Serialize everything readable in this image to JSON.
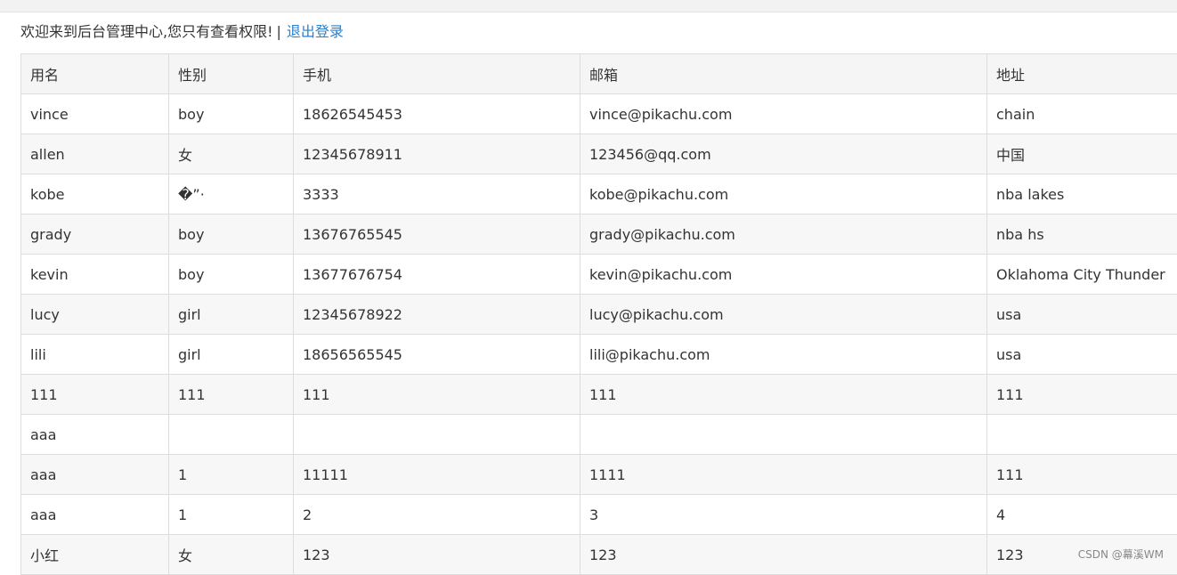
{
  "header": {
    "welcome_text": "欢迎来到后台管理中心,您只有查看权限!",
    "separator": "|",
    "logout_label": "退出登录"
  },
  "table": {
    "columns": [
      "用名",
      "性别",
      "手机",
      "邮箱",
      "地址"
    ],
    "rows": [
      [
        "vince",
        "boy",
        "18626545453",
        "vince@pikachu.com",
        "chain"
      ],
      [
        "allen",
        "女",
        "12345678911",
        "123456@qq.com",
        "中国"
      ],
      [
        "kobe",
        "�”·",
        "3333",
        "kobe@pikachu.com",
        "nba lakes"
      ],
      [
        "grady",
        "boy",
        "13676765545",
        "grady@pikachu.com",
        "nba hs"
      ],
      [
        "kevin",
        "boy",
        "13677676754",
        "kevin@pikachu.com",
        "Oklahoma City Thunder"
      ],
      [
        "lucy",
        "girl",
        "12345678922",
        "lucy@pikachu.com",
        "usa"
      ],
      [
        "lili",
        "girl",
        "18656565545",
        "lili@pikachu.com",
        "usa"
      ],
      [
        "111",
        "111",
        "111",
        "111",
        "111"
      ],
      [
        "aaa",
        "",
        "",
        "",
        ""
      ],
      [
        "aaa",
        "1",
        "11111",
        "1111",
        "111"
      ],
      [
        "aaa",
        "1",
        "2",
        "3",
        "4"
      ],
      [
        "小红",
        "女",
        "123",
        "123",
        "123"
      ]
    ]
  },
  "watermark": "CSDN @幕溪WM",
  "colors": {
    "link": "#2a7fcd",
    "text": "#333333",
    "border": "#dddddd",
    "header_bg": "#f5f5f5",
    "stripe_bg": "#f7f7f7"
  }
}
